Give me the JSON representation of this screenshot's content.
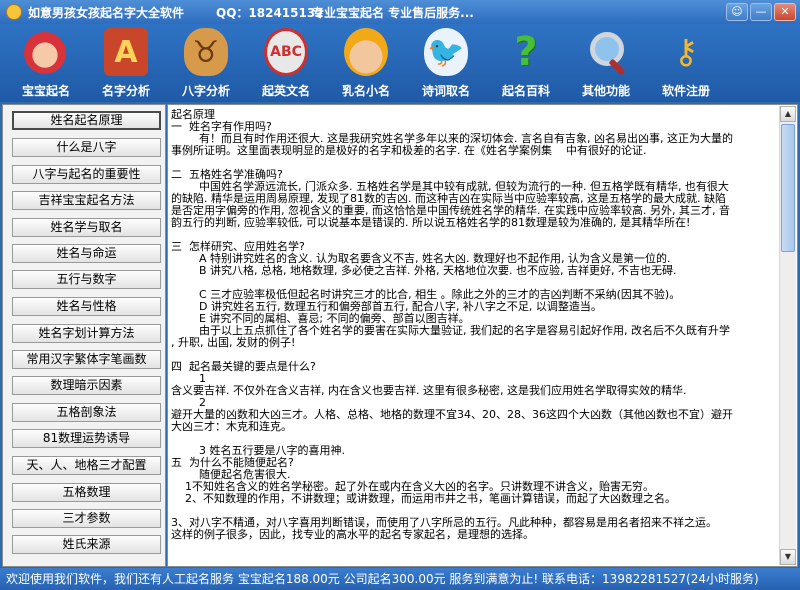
{
  "window": {
    "title": "如意男孩女孩起名字大全软件",
    "qq": "QQ：182415132",
    "slogan": "专业宝宝起名  专业售后服务...",
    "buttons": [
      "☺",
      "—",
      "✕"
    ]
  },
  "toolbar": {
    "items": [
      {
        "label": "宝宝起名",
        "icon": "baby-icon",
        "glyph": ""
      },
      {
        "label": "名字分析",
        "icon": "letter-a-icon",
        "glyph": "A"
      },
      {
        "label": "八字分析",
        "icon": "ox-icon",
        "glyph": "♉"
      },
      {
        "label": "起英文名",
        "icon": "abc-icon",
        "glyph": "ABC"
      },
      {
        "label": "乳名小名",
        "icon": "miner-icon",
        "glyph": ""
      },
      {
        "label": "诗词取名",
        "icon": "bird-icon",
        "glyph": "🐦"
      },
      {
        "label": "起名百科",
        "icon": "question-icon",
        "glyph": "?"
      },
      {
        "label": "其他功能",
        "icon": "magnifier-icon",
        "glyph": ""
      },
      {
        "label": "软件注册",
        "icon": "keys-icon",
        "glyph": "⚷"
      }
    ]
  },
  "nav": {
    "items": [
      "姓名起名原理",
      "什么是八字",
      "八字与起名的重要性",
      "吉祥宝宝起名方法",
      "姓名学与取名",
      "姓名与命运",
      "五行与数字",
      "姓名与性格",
      "姓名字划计算方法",
      "常用汉字繁体字笔画数",
      "数理暗示因素",
      "五格剖象法",
      "81数理运势诱导",
      "天、人、地格三才配置",
      "五格数理",
      "三才参数",
      "姓氏来源"
    ],
    "active_index": 0
  },
  "content": {
    "lines": [
      "起名原理",
      "一  姓名字有作用吗?",
      "        有！而且有时作用还很大. 这是我研究姓名学多年以来的深切体会. 言名自有吉象, 凶名易出凶事, 这正为大量的",
      "事例所证明。这里面表现明显的是极好的名字和极差的名字. 在《姓名学案例集    中有很好的论证.",
      "",
      "二  五格姓名学准确吗?",
      "        中国姓名学源远流长, 门派众多. 五格姓名学是其中较有成就, 但较为流行的一种. 但五格学既有精华, 也有很大",
      "的缺陷. 精华是运用周易原理, 发现了81数的吉凶. 而这种吉凶在实际当中应验率较高, 这是五格学的最大成就. 缺陷",
      "是否定用字偏旁的作用, 忽视含义的重要, 而这恰恰是中国传统姓名学的精华. 在实践中应验率较高. 另外, 其三才, 音",
      "韵五行的判断, 应验率较低, 可以说基本是错误的. 所以说五格姓名学的81数理是较为准确的, 是其精华所在!",
      "",
      "三  怎样研究、应用姓名学?",
      "        A 特别讲究姓名的含义. 认为取名要含义不吉, 姓名大凶. 数理好也不起作用, 认为含义是第一位的.",
      "        B 讲究八格, 总格, 地格数理, 多必使之吉祥. 外格, 天格地位次要. 也不应验, 吉祥更好, 不吉也无碍.",
      "",
      "        C 三才应验率极低但起名时讲究三才的比合, 相生 。除此之外的三才的吉凶判断不采纳(因其不验)。",
      "        D 讲究姓名五行, 数理五行和偏旁部首五行, 配合八字, 补八字之不足, 以调整造当。",
      "        E 讲究不同的属相、喜忌; 不同的偏旁、部首以图吉祥。",
      "        由于以上五点抓住了各个姓名学的要害在实际大量验证, 我们起的名字是容易引起好作用, 改名后不久既有升学",
      ", 升职, 出国, 发财的例子!",
      "",
      "四  起名最关键的要点是什么?",
      "        1",
      "含义要吉祥. 不仅外在含义吉祥, 内在含义也要吉祥. 这里有很多秘密, 这是我们应用姓名学取得实效的精华.",
      "        2",
      "避开大量的凶数和大凶三才。人格、总格、地格的数理不宜34、20、28、36这四个大凶数（其他凶数也不宜）避开",
      "大凶三才：木克和连克。",
      "",
      "        3 姓名五行要是八字的喜用神.",
      "五  为什么不能随便起名?",
      "        随便起名危害很大.",
      "    1不知姓名含义的姓名学秘密。起了外在或内在含义大凶的名字。只讲数理不讲含义，贻害无穷。",
      "    2、不知数理的作用，不讲数理；或讲数理，而运用市井之书，笔画计算错误，而起了大凶数理之名。",
      "",
      "3、对八字不精通，对八字喜用判断错误，而使用了八字所忌的五行。凡此种种，都容易是用名者招来不祥之运。",
      "这样的例子很多，因此，找专业的高水平的起名专家起名，是理想的选择。"
    ]
  },
  "status": {
    "text": "欢迎使用我们软件，我们还有人工起名服务  宝宝起名188.00元  公司起名300.00元  服务到满意为止!   联系电话：13982281527(24小时服务)"
  },
  "colors": {
    "accent": "#2d6ab0",
    "toolbar": "#2f73c4",
    "content_bg": "#ffffff"
  }
}
